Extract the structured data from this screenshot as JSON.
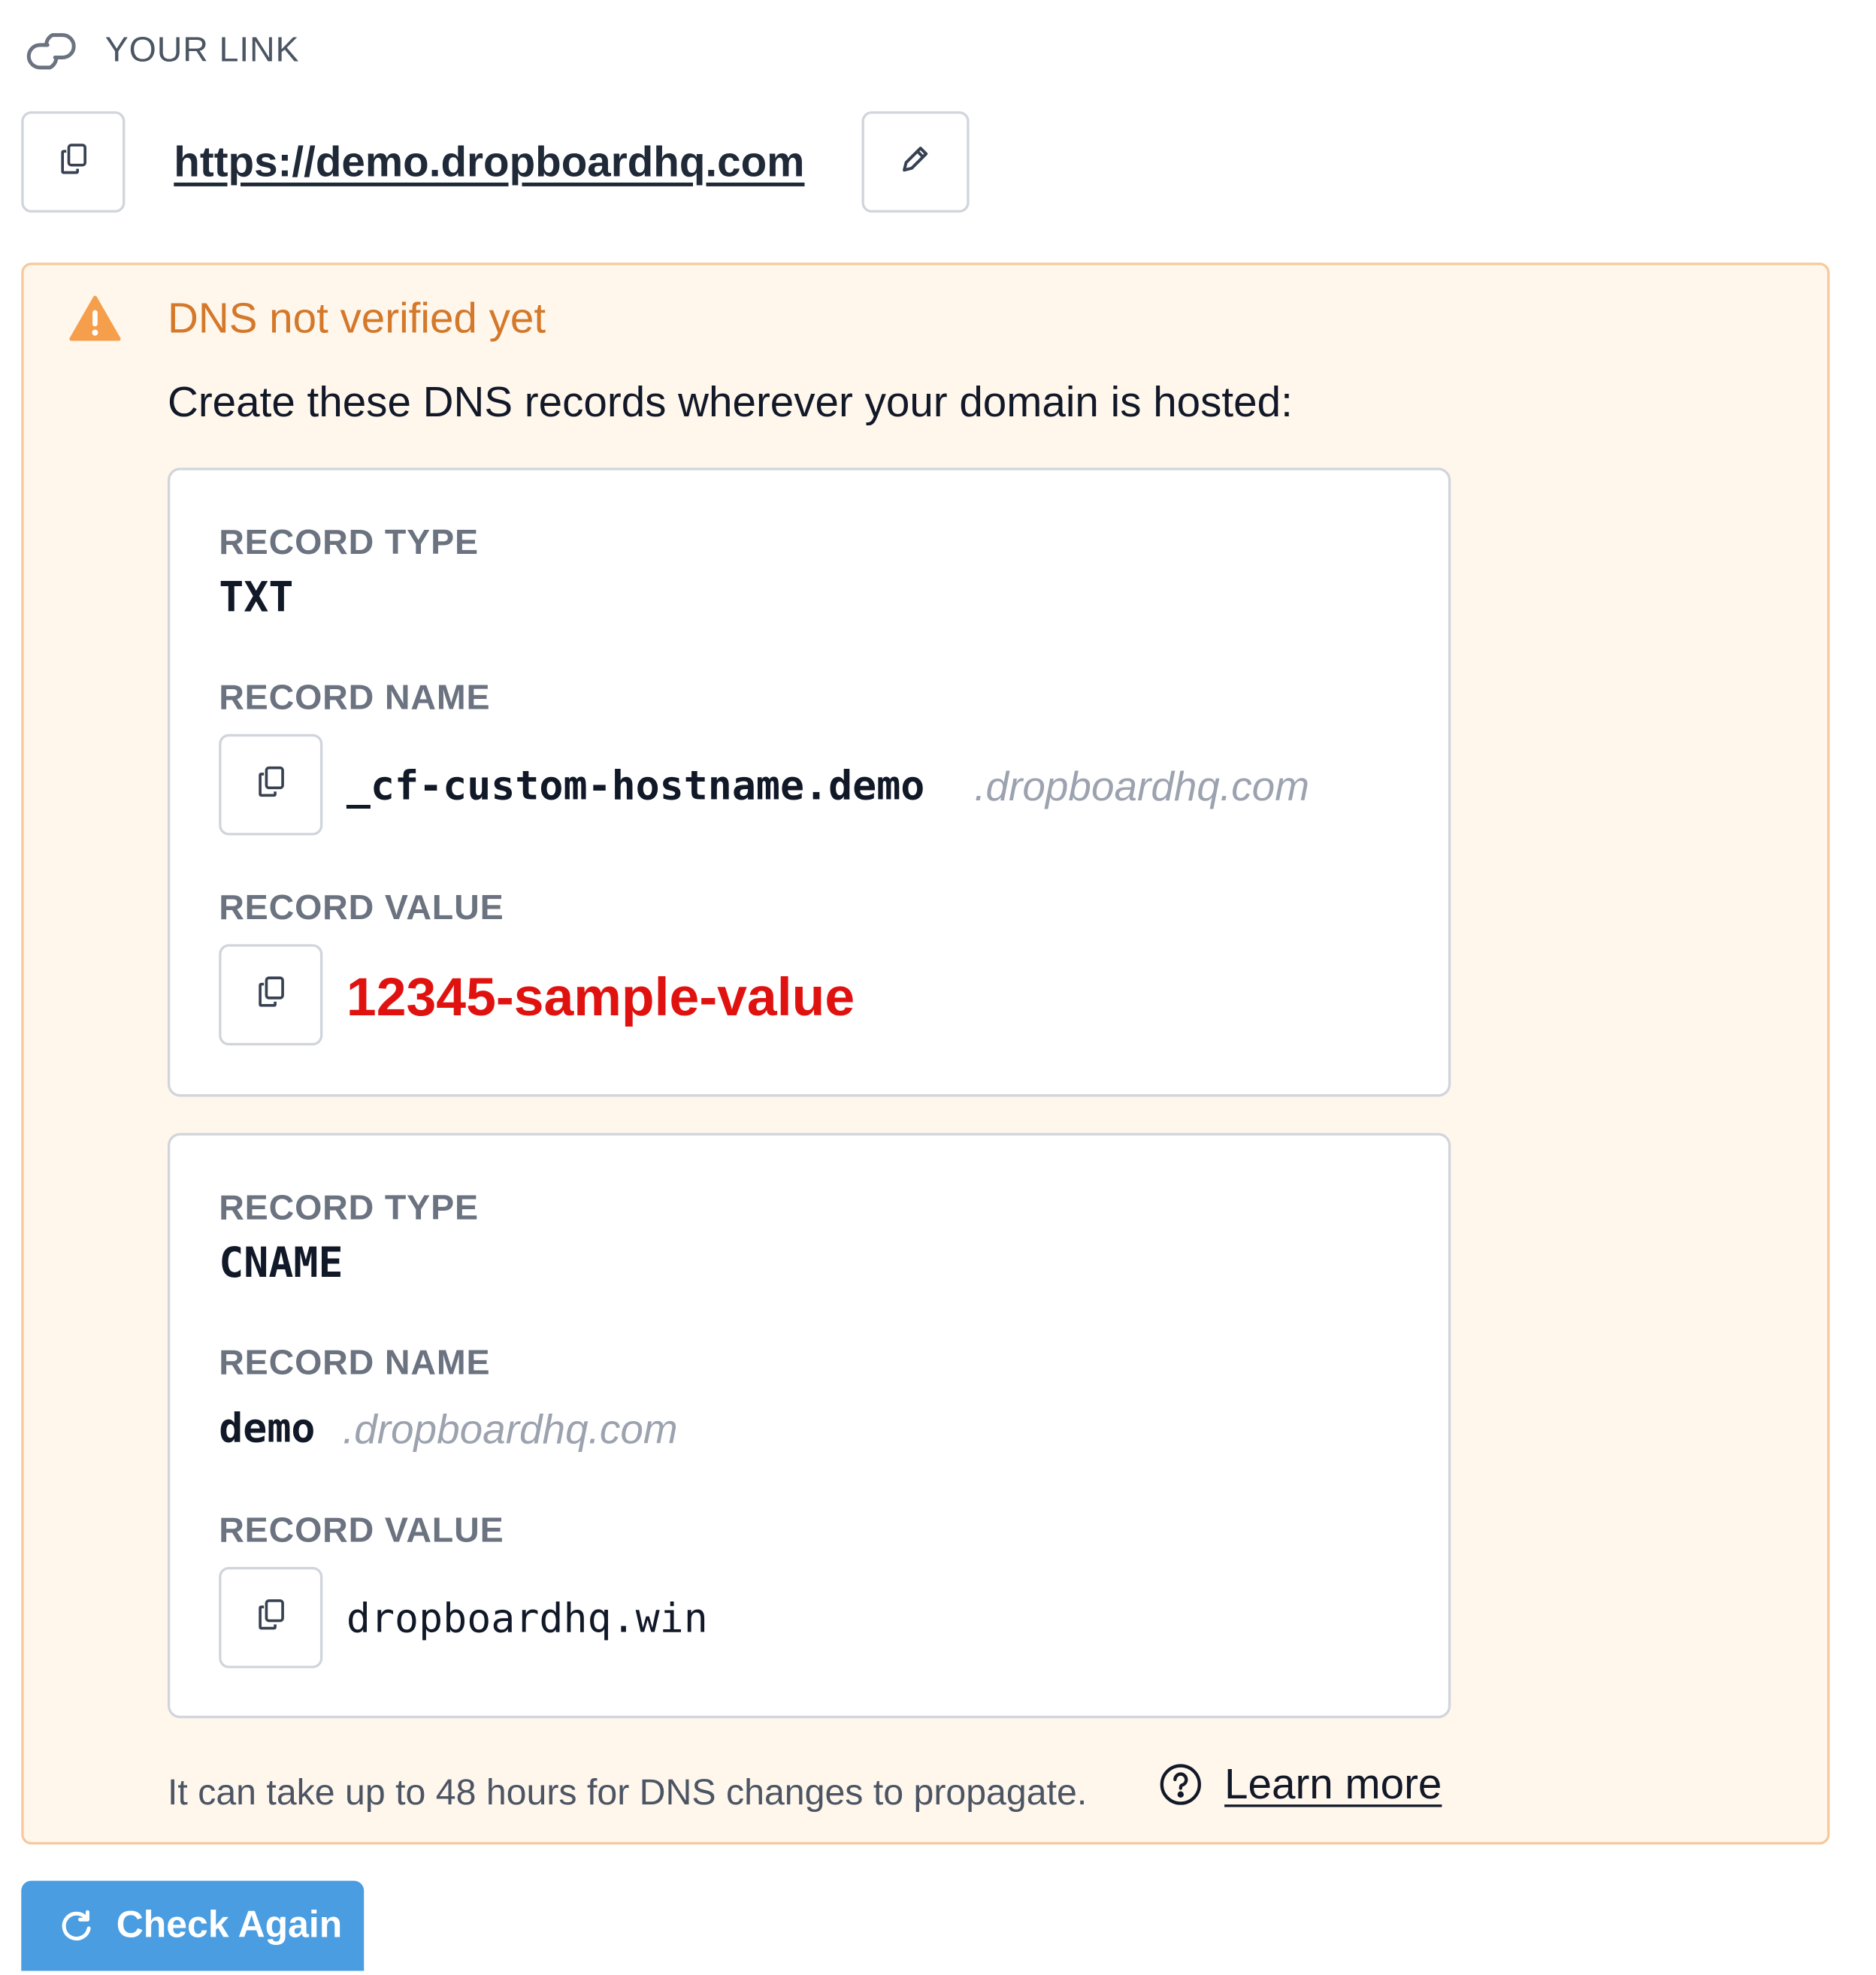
{
  "header": {
    "section_label": "YOUR LINK",
    "link_icon": "link-icon",
    "url": "https://demo.dropboardhq.com",
    "copy_icon": "copy-icon",
    "edit_icon": "pencil-icon"
  },
  "alert": {
    "icon": "warning-triangle-icon",
    "title": "DNS not verified yet",
    "description": "Create these DNS records wherever your domain is hosted:",
    "colors": {
      "background": "#fff6ec",
      "border": "#f7c99c",
      "title": "#d4782a",
      "icon": "#f59e4b"
    }
  },
  "records": [
    {
      "type_label": "RECORD TYPE",
      "type": "TXT",
      "name_label": "RECORD NAME",
      "name": "_cf-custom-hostname.demo",
      "name_suffix": ".dropboardhq.com",
      "value_label": "RECORD VALUE",
      "value": "12345-sample-value",
      "value_color": "#e0120f"
    },
    {
      "type_label": "RECORD TYPE",
      "type": "CNAME",
      "name_label": "RECORD NAME",
      "name": "demo",
      "name_suffix": ".dropboardhq.com",
      "value_label": "RECORD VALUE",
      "value": "dropboardhq.win"
    }
  ],
  "footer": {
    "note": "It can take up to 48 hours for DNS changes to propagate.",
    "help_icon": "question-circle-icon",
    "learn_more": "Learn more"
  },
  "actions": {
    "check_again": "Check Again",
    "check_again_icon": "refresh-icon",
    "check_again_color": "#4a9de0"
  }
}
